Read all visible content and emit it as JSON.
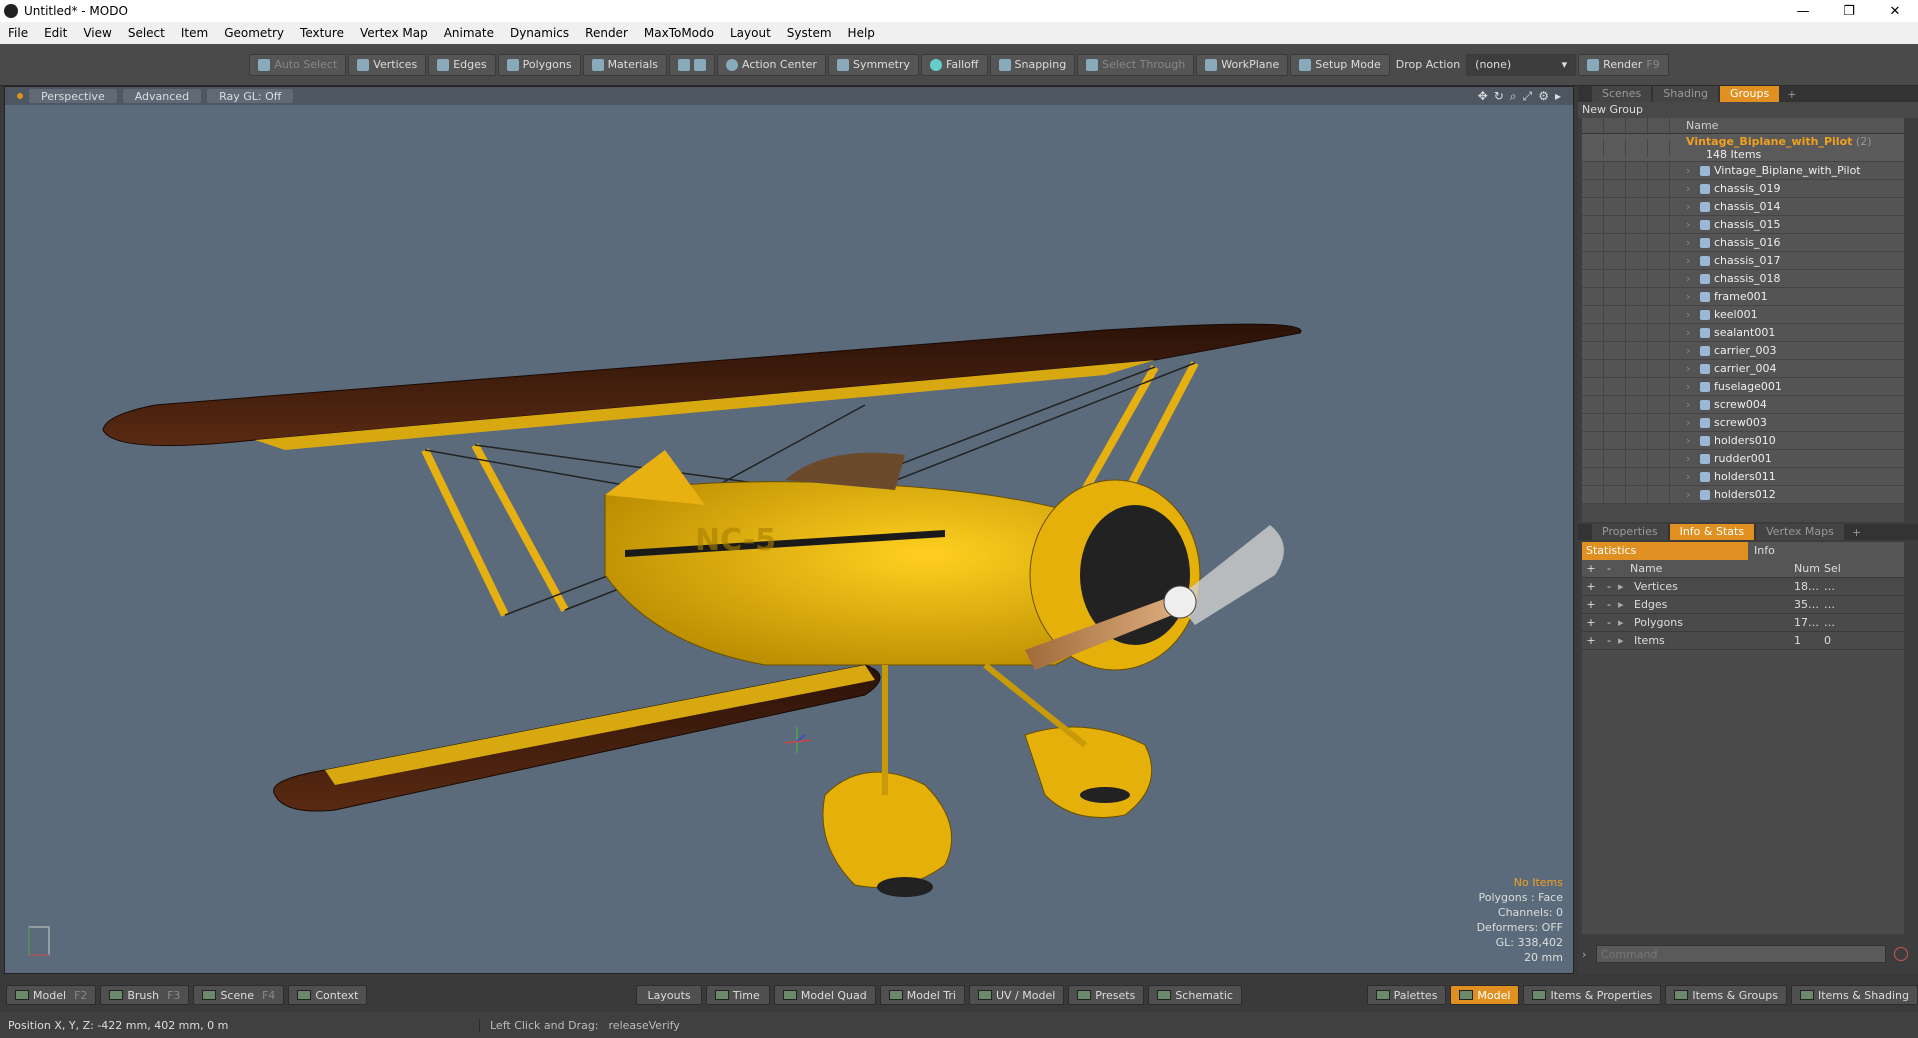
{
  "window": {
    "title": "Untitled* - MODO",
    "minimize": "—",
    "maximize": "❐",
    "close": "✕"
  },
  "menu": [
    "File",
    "Edit",
    "View",
    "Select",
    "Item",
    "Geometry",
    "Texture",
    "Vertex Map",
    "Animate",
    "Dynamics",
    "Render",
    "MaxToModo",
    "Layout",
    "System",
    "Help"
  ],
  "toolbar": {
    "auto_select": "Auto Select",
    "vertices": "Vertices",
    "edges": "Edges",
    "polygons": "Polygons",
    "materials": "Materials",
    "action_center": "Action Center",
    "symmetry": "Symmetry",
    "falloff": "Falloff",
    "snapping": "Snapping",
    "select_through": "Select Through",
    "workplane": "WorkPlane",
    "setup_mode": "Setup Mode",
    "drop_action": "Drop Action",
    "drop_action_value": "(none)",
    "render": "Render",
    "render_key": "F9"
  },
  "viewport": {
    "tabs": [
      "Perspective",
      "Advanced",
      "Ray GL: Off"
    ],
    "stats": {
      "items": "No Items",
      "polygons": "Polygons : Face",
      "channels": "Channels: 0",
      "deformers": "Deformers: OFF",
      "gl": "GL: 338,402",
      "scale": "20 mm"
    },
    "fuselage_text": "NC-5",
    "colors": {
      "bg": "#5b6b7b",
      "body": "#f2b70a",
      "wing_top": "#3a1a10"
    }
  },
  "groups_panel": {
    "tabs": [
      "Scenes",
      "Shading",
      "Groups"
    ],
    "active_tab": "Groups",
    "new_group": "New Group",
    "name_header": "Name",
    "root": {
      "name": "Vintage_Biplane_with_Pilot",
      "count_suffix": "(2)",
      "items_label": "148 Items"
    },
    "items": [
      "Vintage_Biplane_with_Pilot",
      "chassis_019",
      "chassis_014",
      "chassis_015",
      "chassis_016",
      "chassis_017",
      "chassis_018",
      "frame001",
      "keel001",
      "sealant001",
      "carrier_003",
      "carrier_004",
      "fuselage001",
      "screw004",
      "screw003",
      "holders010",
      "rudder001",
      "holders011",
      "holders012"
    ]
  },
  "info_panel": {
    "tabs": [
      "Properties",
      "Info & Stats",
      "Vertex Maps"
    ],
    "active_tab": "Info & Stats",
    "subtabs": [
      "Statistics",
      "Info"
    ],
    "headers": {
      "name": "Name",
      "num": "Num",
      "sel": "Sel"
    },
    "rows": [
      {
        "name": "Vertices",
        "num": "18…",
        "sel": "…"
      },
      {
        "name": "Edges",
        "num": "35…",
        "sel": "…"
      },
      {
        "name": "Polygons",
        "num": "17…",
        "sel": "…"
      },
      {
        "name": "Items",
        "num": "1",
        "sel": "0"
      }
    ],
    "command_placeholder": "Command"
  },
  "bottombar": {
    "left": [
      {
        "label": "Model",
        "key": "F2"
      },
      {
        "label": "Brush",
        "key": "F3"
      },
      {
        "label": "Scene",
        "key": "F4"
      },
      {
        "label": "Context",
        "key": ""
      }
    ],
    "center": [
      "Layouts",
      "Time",
      "Model Quad",
      "Model Tri",
      "UV / Model",
      "Presets",
      "Schematic"
    ],
    "right": [
      "Palettes",
      "Model",
      "Items & Properties",
      "Items & Groups",
      "Items & Shading"
    ],
    "active": "Model"
  },
  "statusbar": {
    "position": "Position X, Y, Z:  -422 mm, 402 mm, 0 m",
    "hint_label": "Left Click and Drag:",
    "hint_value": "releaseVerify"
  }
}
